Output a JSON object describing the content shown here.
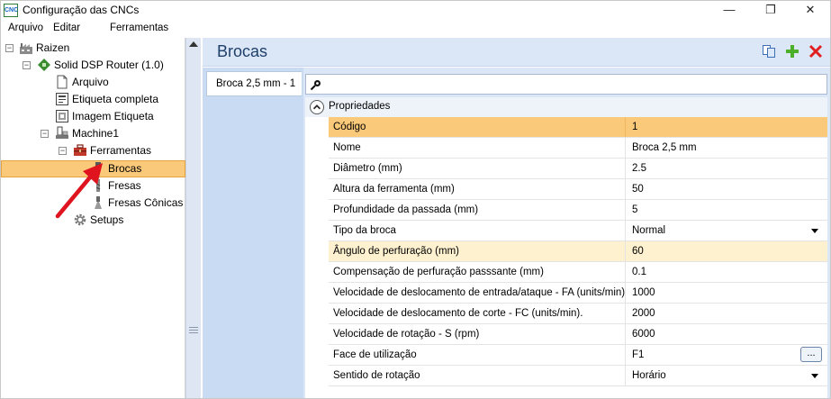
{
  "window": {
    "title": "Configuração das CNCs",
    "app_icon_text": "CNC",
    "minimize_glyph": "—",
    "maximize_glyph": "❐",
    "close_glyph": "✕"
  },
  "menu": {
    "items": [
      "Arquivo",
      "Editar",
      "Ferramentas"
    ]
  },
  "tree": {
    "root": "Raizen",
    "router": "Solid DSP Router (1.0)",
    "arquivo": "Arquivo",
    "etiqueta": "Etiqueta completa",
    "imagem": "Imagem Etiqueta",
    "machine": "Machine1",
    "ferramentas": "Ferramentas",
    "brocas": "Brocas",
    "fresas": "Fresas",
    "fresas_conicas": "Fresas Cônicas",
    "setups": "Setups",
    "expand_glyph": "−"
  },
  "panel": {
    "title": "Brocas",
    "tab_label": "Broca 2,5 mm - 1",
    "group_label": "Propriedades",
    "ellipsis": "..."
  },
  "properties": [
    {
      "name": "Código",
      "value": "1"
    },
    {
      "name": "Nome",
      "value": "Broca 2,5 mm"
    },
    {
      "name": "Diâmetro (mm)",
      "value": "2.5"
    },
    {
      "name": "Altura da ferramenta (mm)",
      "value": "50"
    },
    {
      "name": "Profundidade da passada (mm)",
      "value": "5"
    },
    {
      "name": "Tipo da broca",
      "value": "Normal"
    },
    {
      "name": "Ângulo de perfuração (mm)",
      "value": "60"
    },
    {
      "name": "Compensação de perfuração passsante (mm)",
      "value": "0.1"
    },
    {
      "name": "Velocidade de deslocamento de entrada/ataque - FA (units/min)",
      "value": "1000"
    },
    {
      "name": "Velocidade de deslocamento de corte - FC (units/min).",
      "value": "2000"
    },
    {
      "name": "Velocidade de rotação - S (rpm)",
      "value": "6000"
    },
    {
      "name": "Face de utilização",
      "value": "F1"
    },
    {
      "name": "Sentido de rotação",
      "value": "Horário"
    }
  ],
  "colors": {
    "selection": "#fbc97a",
    "highlight": "#fdf1cf",
    "header_bg": "#dbe7f6",
    "annotation_arrow": "#e0141e"
  }
}
